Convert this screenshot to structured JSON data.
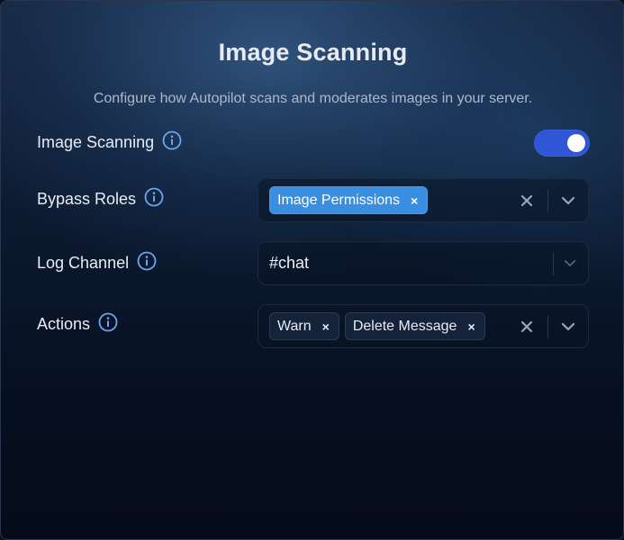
{
  "header": {
    "title": "Image Scanning",
    "subtitle": "Configure how Autopilot scans and moderates images in your server."
  },
  "settings": {
    "image_scanning": {
      "label": "Image Scanning",
      "info_icon": "info-icon",
      "enabled": true,
      "accent_color": "#2f56d6"
    },
    "bypass_roles": {
      "label": "Bypass Roles",
      "info_icon": "info-icon",
      "chips": [
        {
          "label": "Image Permissions",
          "remove": "×",
          "color": "#3a8ee0"
        }
      ],
      "clear_icon": "close-icon",
      "dropdown_icon": "chevron-down-icon"
    },
    "log_channel": {
      "label": "Log Channel",
      "info_icon": "info-icon",
      "value": "#chat",
      "dropdown_icon": "chevron-down-icon"
    },
    "actions": {
      "label": "Actions",
      "info_icon": "info-icon",
      "chips": [
        {
          "label": "Warn",
          "remove": "×"
        },
        {
          "label": "Delete Message",
          "remove": "×"
        }
      ],
      "clear_icon": "close-icon",
      "dropdown_icon": "chevron-down-icon"
    }
  }
}
